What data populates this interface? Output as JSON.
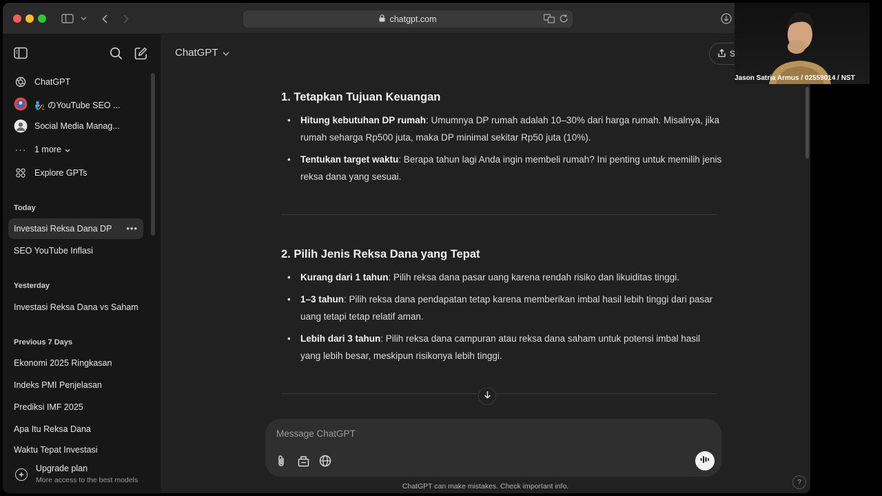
{
  "browser": {
    "url": "chatgpt.com"
  },
  "sidebar": {
    "pinned": [
      {
        "label": "ChatGPT",
        "icon": "openai-logo-icon"
      },
      {
        "label": "🧞 のYouTube SEO ...",
        "icon": "gpt-avatar-icon"
      },
      {
        "label": "Social Media Manag...",
        "icon": "gpt-avatar-icon"
      }
    ],
    "more_label": "1 more",
    "explore_label": "Explore GPTs",
    "sections": {
      "today": "Today",
      "yesterday": "Yesterday",
      "prev7": "Previous 7 Days"
    },
    "today_chats": [
      "Investasi Reksa Dana DP",
      "SEO YouTube Inflasi"
    ],
    "yesterday_chats": [
      "Investasi Reksa Dana vs Saham"
    ],
    "prev7_chats": [
      "Ekonomi 2025 Ringkasan",
      "Indeks PMI Penjelasan",
      "Prediksi IMF 2025",
      "Apa Itu Reksa Dana",
      "Waktu Tepat Investasi"
    ],
    "upgrade": {
      "title": "Upgrade plan",
      "subtitle": "More access to the best models"
    }
  },
  "header": {
    "model": "ChatGPT",
    "share_label": "S"
  },
  "content": {
    "section1": {
      "title": "1. Tetapkan Tujuan Keuangan",
      "bullets": [
        {
          "bold": "Hitung kebutuhan DP rumah",
          "text": ": Umumnya DP rumah adalah 10–30% dari harga rumah. Misalnya, jika rumah seharga Rp500 juta, maka DP minimal sekitar Rp50 juta (10%)."
        },
        {
          "bold": "Tentukan target waktu",
          "text": ": Berapa tahun lagi Anda ingin membeli rumah? Ini penting untuk memilih jenis reksa dana yang sesuai."
        }
      ]
    },
    "section2": {
      "title": "2. Pilih Jenis Reksa Dana yang Tepat",
      "bullets": [
        {
          "bold": "Kurang dari 1 tahun",
          "text": ": Pilih reksa dana pasar uang karena rendah risiko dan likuiditas tinggi."
        },
        {
          "bold": "1–3 tahun",
          "text": ": Pilih reksa dana pendapatan tetap karena memberikan imbal hasil lebih tinggi dari pasar uang tetapi tetap relatif aman."
        },
        {
          "bold": "Lebih dari 3 tahun",
          "text": ": Pilih reksa dana campuran atau reksa dana saham untuk potensi imbal hasil yang lebih besar, meskipun risikonya lebih tinggi."
        }
      ]
    }
  },
  "composer": {
    "placeholder": "Message ChatGPT"
  },
  "footer": {
    "disclaimer": "ChatGPT can make mistakes. Check important info.",
    "help": "?"
  },
  "webcam": {
    "label": "Jason Satria Armus / 02559014 / NST"
  },
  "colors": {
    "background": "#212121",
    "sidebar": "#171717",
    "text": "#ececec"
  }
}
